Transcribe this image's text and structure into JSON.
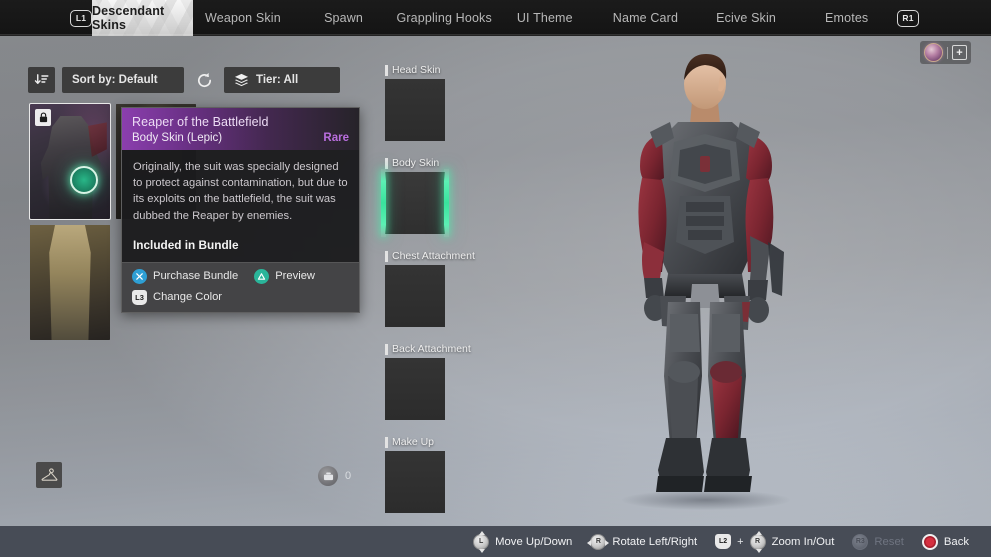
{
  "topbar": {
    "left_bumper": "L1",
    "right_bumper": "R1",
    "tabs": [
      {
        "label": "Descendant Skins",
        "active": true
      },
      {
        "label": "Weapon Skin",
        "active": false
      },
      {
        "label": "Spawn",
        "active": false
      },
      {
        "label": "Grappling Hooks",
        "active": false
      },
      {
        "label": "UI Theme",
        "active": false
      },
      {
        "label": "Name Card",
        "active": false
      },
      {
        "label": "Ecive Skin",
        "active": false
      },
      {
        "label": "Emotes",
        "active": false
      }
    ]
  },
  "currency_top": {
    "icon": "caliber-orb-icon",
    "add_label": "+"
  },
  "filterbar": {
    "sort_icon": "sort-descending-icon",
    "sort_label": "Sort by: Default",
    "refresh_icon": "refresh-icon",
    "tier_icon": "layers-icon",
    "tier_label": "Tier: All"
  },
  "grid": {
    "items": [
      {
        "name": "item-card-reaper",
        "locked": true,
        "selected": true
      },
      {
        "name": "item-card-second",
        "locked": true,
        "selected": false
      },
      {
        "name": "item-card-third",
        "locked": false,
        "selected": false
      }
    ]
  },
  "tooltip": {
    "title": "Reaper of the Battlefield",
    "subtitle": "Body Skin (Lepic)",
    "rarity": "Rare",
    "rarity_color": "#b96ede",
    "description": "Originally, the suit was specially designed to protect against contamination, but due to its exploits on the battlefield, the suit was dubbed the Reaper by enemies.",
    "bundle_label": "Included in Bundle",
    "actions": [
      {
        "button": "cross",
        "label": "Purchase Bundle"
      },
      {
        "button": "triangle",
        "label": "Preview"
      },
      {
        "button": "L3",
        "label": "Change Color"
      }
    ]
  },
  "slots": [
    {
      "label": "Head Skin",
      "active": false
    },
    {
      "label": "Body Skin",
      "active": true
    },
    {
      "label": "Chest Attachment",
      "active": false
    },
    {
      "label": "Back Attachment",
      "active": false
    },
    {
      "label": "Make Up",
      "active": false
    }
  ],
  "footer_left": {
    "wardrobe_icon": "clothes-hanger-icon",
    "coin_icon": "currency-icon",
    "coin_count": "0"
  },
  "hints": [
    {
      "icon": "left-stick-updown-icon",
      "glyph": "L",
      "label": "Move Up/Down",
      "disabled": false
    },
    {
      "icon": "right-stick-leftright-icon",
      "glyph": "R",
      "label": "Rotate Left/Right",
      "disabled": false
    },
    {
      "icon": "l2-trigger-icon",
      "glyph": "L2",
      "label": "Zoom In/Out",
      "plus": "+",
      "glyph2": "R",
      "disabled": false
    },
    {
      "icon": "right-stick-press-icon",
      "glyph": "R3",
      "label": "Reset",
      "disabled": true
    },
    {
      "icon": "circle-button-icon",
      "label": "Back",
      "disabled": false
    }
  ],
  "accent": {
    "green": "#39e39d",
    "purple": "#8b3fae",
    "red": "#d53040"
  }
}
